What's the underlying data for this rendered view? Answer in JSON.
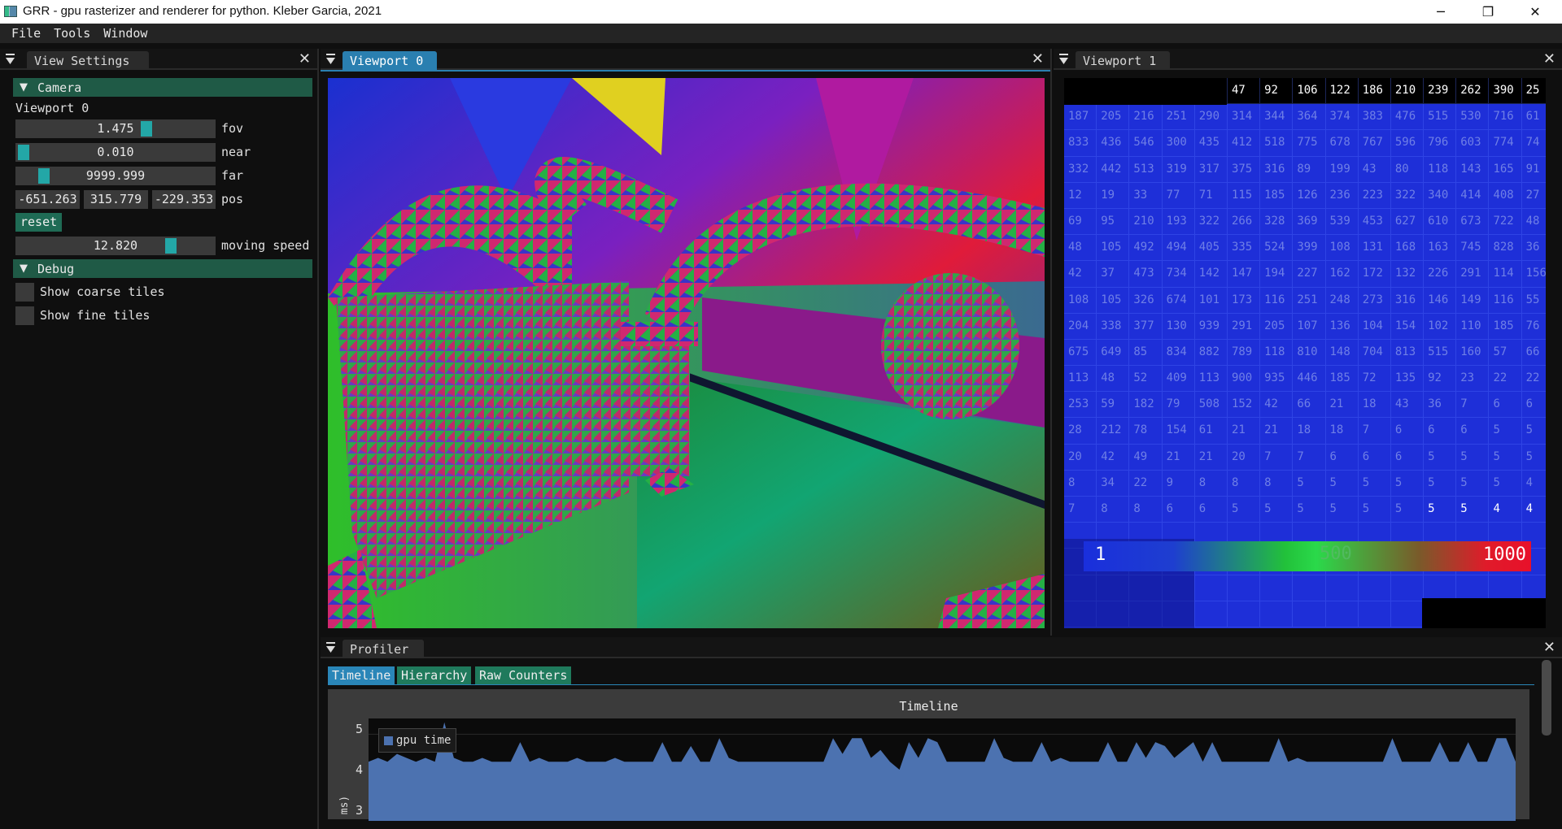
{
  "window": {
    "title": "GRR - gpu rasterizer and renderer for python. Kleber Garcia, 2021",
    "minimize": "─",
    "maximize": "❐",
    "close": "✕"
  },
  "menu": [
    "File",
    "Tools",
    "Window"
  ],
  "view_settings": {
    "tab": "View Settings",
    "camera_header": "Camera",
    "viewport_label": "Viewport 0",
    "fov": {
      "value": "1.475",
      "label": "fov",
      "level": 0.12
    },
    "near": {
      "value": "0.010",
      "label": "near",
      "level": 0.0
    },
    "far": {
      "value": "9999.999",
      "label": "far",
      "level": 0.1
    },
    "pos": {
      "x": "-651.263",
      "y": "315.779",
      "z": "-229.353",
      "label": "pos"
    },
    "reset": "reset",
    "moving_speed": {
      "value": "12.820",
      "label": "moving speed",
      "level": 0.7
    },
    "debug_header": "Debug",
    "show_coarse": "Show coarse tiles",
    "show_fine": "Show fine tiles"
  },
  "viewport0": {
    "tab": "Viewport 0"
  },
  "viewport1": {
    "tab": "Viewport 1",
    "legend_min": "1",
    "legend_mid": "500",
    "legend_max": "1000",
    "header_row": [
      "47",
      "92",
      "106",
      "122",
      "186",
      "210",
      "239",
      "262",
      "390",
      "25"
    ],
    "rows": [
      [
        "187",
        "205",
        "216",
        "251",
        "290",
        "314",
        "344",
        "364",
        "374",
        "383",
        "476",
        "515",
        "530",
        "716",
        "61"
      ],
      [
        "833",
        "436",
        "546",
        "300",
        "435",
        "412",
        "518",
        "775",
        "678",
        "767",
        "596",
        "796",
        "603",
        "774",
        "74"
      ],
      [
        "332",
        "442",
        "513",
        "319",
        "317",
        "375",
        "316",
        "89",
        "199",
        "43",
        "80",
        "118",
        "143",
        "165",
        "91"
      ],
      [
        "12",
        "19",
        "33",
        "77",
        "71",
        "115",
        "185",
        "126",
        "236",
        "223",
        "322",
        "340",
        "414",
        "408",
        "27"
      ],
      [
        "69",
        "95",
        "210",
        "193",
        "322",
        "266",
        "328",
        "369",
        "539",
        "453",
        "627",
        "610",
        "673",
        "722",
        "48"
      ],
      [
        "48",
        "105",
        "492",
        "494",
        "405",
        "335",
        "524",
        "399",
        "108",
        "131",
        "168",
        "163",
        "745",
        "828",
        "36"
      ],
      [
        "42",
        "37",
        "473",
        "734",
        "142",
        "147",
        "194",
        "227",
        "162",
        "172",
        "132",
        "226",
        "291",
        "114",
        "156"
      ],
      [
        "108",
        "105",
        "326",
        "674",
        "101",
        "173",
        "116",
        "251",
        "248",
        "273",
        "316",
        "146",
        "149",
        "116",
        "55"
      ],
      [
        "204",
        "338",
        "377",
        "130",
        "939",
        "291",
        "205",
        "107",
        "136",
        "104",
        "154",
        "102",
        "110",
        "185",
        "76"
      ],
      [
        "675",
        "649",
        "85",
        "834",
        "882",
        "789",
        "118",
        "810",
        "148",
        "704",
        "813",
        "515",
        "160",
        "57",
        "66"
      ],
      [
        "113",
        "48",
        "52",
        "409",
        "113",
        "900",
        "935",
        "446",
        "185",
        "72",
        "135",
        "92",
        "23",
        "22",
        "22"
      ],
      [
        "253",
        "59",
        "182",
        "79",
        "508",
        "152",
        "42",
        "66",
        "21",
        "18",
        "43",
        "36",
        "7",
        "6",
        "6"
      ],
      [
        "28",
        "212",
        "78",
        "154",
        "61",
        "21",
        "21",
        "18",
        "18",
        "7",
        "6",
        "6",
        "6",
        "5",
        "5"
      ],
      [
        "20",
        "42",
        "49",
        "21",
        "21",
        "20",
        "7",
        "7",
        "6",
        "6",
        "6",
        "5",
        "5",
        "5",
        "5"
      ],
      [
        "8",
        "34",
        "22",
        "9",
        "8",
        "8",
        "8",
        "5",
        "5",
        "5",
        "5",
        "5",
        "5",
        "5",
        "4"
      ],
      [
        "7",
        "8",
        "8",
        "6",
        "6",
        "5",
        "5",
        "5",
        "5",
        "5",
        "5",
        "5",
        "5",
        "4",
        "4"
      ]
    ]
  },
  "profiler": {
    "tab": "Profiler",
    "tabs": [
      "Timeline",
      "Hierarchy",
      "Raw Counters"
    ],
    "chart_title": "Timeline",
    "legend": "gpu time",
    "ylabel": "ms)",
    "yticks": [
      "5",
      "4",
      "3"
    ]
  },
  "chart_data": {
    "type": "area",
    "title": "Timeline",
    "series": [
      {
        "name": "gpu time",
        "values": [
          4.3,
          4.4,
          4.3,
          4.5,
          4.4,
          4.3,
          4.4,
          4.3,
          5.3,
          4.4,
          4.3,
          4.3,
          4.4,
          4.3,
          4.3,
          4.3,
          4.8,
          4.3,
          4.4,
          4.3,
          4.3,
          4.3,
          4.4,
          4.3,
          4.3,
          4.3,
          4.4,
          4.3,
          4.3,
          4.3,
          4.3,
          4.8,
          4.3,
          4.3,
          4.7,
          4.3,
          4.3,
          4.9,
          4.4,
          4.3,
          4.3,
          4.3,
          4.3,
          4.3,
          4.3,
          4.3,
          4.3,
          4.3,
          4.3,
          4.9,
          4.5,
          4.9,
          4.9,
          4.4,
          4.6,
          4.3,
          4.1,
          4.8,
          4.4,
          4.9,
          4.8,
          4.3,
          4.3,
          4.3,
          4.3,
          4.3,
          4.9,
          4.4,
          4.3,
          4.3,
          4.3,
          4.8,
          4.3,
          4.4,
          4.3,
          4.3,
          4.3,
          4.3,
          4.8,
          4.3,
          4.3,
          4.8,
          4.4,
          4.8,
          4.7,
          4.4,
          4.6,
          4.8,
          4.3,
          4.8,
          4.3,
          4.3,
          4.3,
          4.3,
          4.3,
          4.3,
          4.9,
          4.3,
          4.4,
          4.3,
          4.3,
          4.3,
          4.3,
          4.3,
          4.3,
          4.3,
          4.3,
          4.3,
          4.9,
          4.3,
          4.3,
          4.3,
          4.3,
          4.8,
          4.3,
          4.3,
          4.8,
          4.3,
          4.3,
          4.9,
          4.9,
          4.3
        ]
      }
    ],
    "ylim": [
      2.8,
      5.4
    ],
    "yticks": [
      5,
      4,
      3
    ],
    "legend_position": "top-left"
  }
}
